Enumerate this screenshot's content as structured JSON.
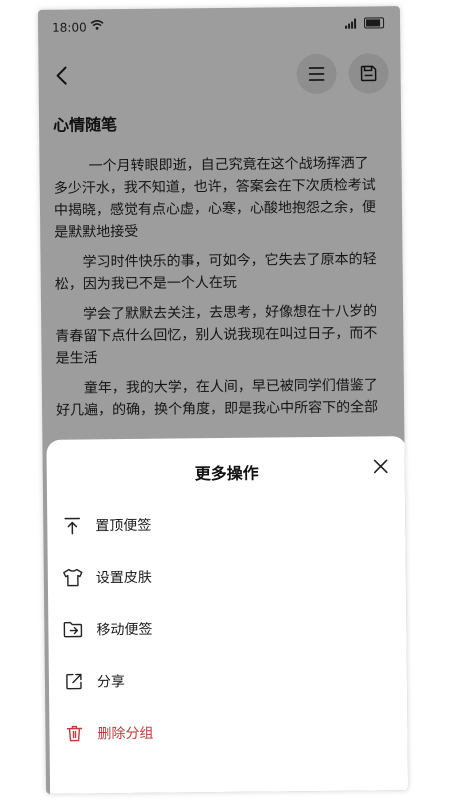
{
  "status": {
    "time": "18:00"
  },
  "note": {
    "title": "心情随笔",
    "paragraphs": [
      "一个月转眼即逝，自己究竟在这个战场挥洒了多少汗水，我不知道，也许，答案会在下次质检考试中揭晓，感觉有点心虚，心寒，心酸地抱怨之余，便是默默地接受",
      "学习时件快乐的事，可如今，它失去了原本的轻松，因为我已不是一个人在玩",
      "学会了默默去关注，去思考，好像想在十八岁的青春留下点什么回忆，别人说我现在叫过日子，而不是生活",
      "童年，我的大学，在人间，早已被同学们借鉴了好几遍，的确，换个角度，即是我心中所容下的全部"
    ]
  },
  "sheet": {
    "title": "更多操作",
    "items": [
      {
        "label": "置顶便签",
        "icon": "pin-top-icon"
      },
      {
        "label": "设置皮肤",
        "icon": "shirt-icon"
      },
      {
        "label": "移动便签",
        "icon": "move-folder-icon"
      },
      {
        "label": "分享",
        "icon": "share-icon"
      },
      {
        "label": "删除分组",
        "icon": "trash-icon"
      }
    ]
  },
  "colors": {
    "overlay": "#9d9d9d",
    "danger": "#c03a3a",
    "text": "#1a1a1a"
  }
}
